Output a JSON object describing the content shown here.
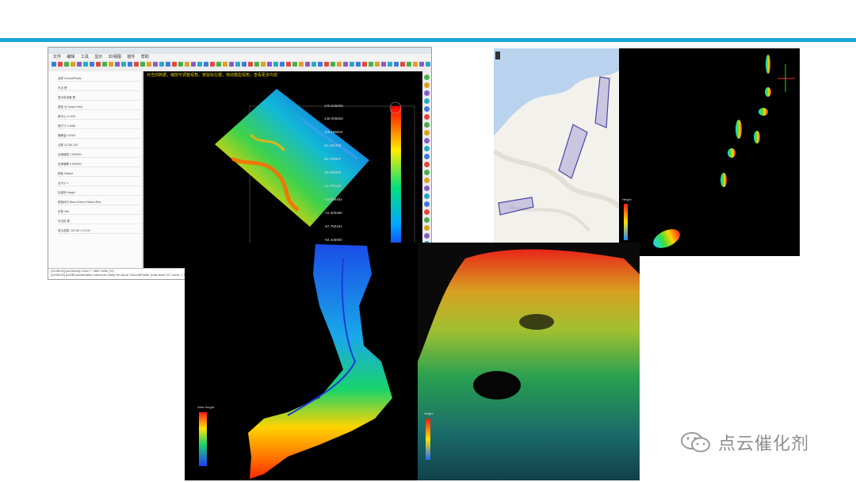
{
  "slide": {
    "accent_color": "#1aa7d8",
    "watermark": {
      "icon": "wechat-icon",
      "text": "点云催化剂"
    }
  },
  "cloudcompare": {
    "menu": [
      "文件",
      "编辑",
      "工具",
      "显示",
      "3D视图",
      "插件",
      "帮助"
    ],
    "notice": "对当前数据，缩放可调整视角，按鼠标左键，拖动模型视角，查看更多内容",
    "properties": [
      {
        "label": "名称",
        "value": "GroundPoints"
      },
      {
        "label": "可见",
        "value": "是"
      },
      {
        "label": "显示色深度",
        "value": "是"
      },
      {
        "label": "类型",
        "value": "点 Scalar Field"
      },
      {
        "label": "框中心",
        "value": "0.1234"
      },
      {
        "label": "框尺寸",
        "value": "2.3456"
      },
      {
        "label": "偏移量",
        "value": "0.0000"
      },
      {
        "label": "点数",
        "value": "24,301,347"
      },
      {
        "label": "全局缩放",
        "value": "1.000000"
      },
      {
        "label": "全局偏移",
        "value": "0.000000"
      },
      {
        "label": "颜色",
        "value": "Default"
      },
      {
        "label": "点大小",
        "value": "1"
      },
      {
        "label": "标量场",
        "value": "Height"
      },
      {
        "label": "颜色标尺",
        "value": "Blue>Green>Yellow>Red"
      },
      {
        "label": "步数",
        "value": "256"
      },
      {
        "label": "可见性",
        "value": "是"
      },
      {
        "label": "显示范围",
        "value": "-122.96 / 170.03"
      }
    ],
    "scale_values": [
      "170.025000",
      "146.006826",
      "119.188202",
      "92.425409",
      "65.730607",
      "39.005093",
      "12.375134",
      "-14.528454",
      "-41.400465",
      "-67.750151",
      "-94.448000",
      "-122.988754"
    ],
    "console": [
      "[15:06:00] [ccOctree] Level 7: 9867 cells (+0)",
      "[15:06:00] [ccOctree] Level 8: 34898 cells (+0)",
      "[15:06:00] [ccOctree] Level 9: 127495 cells (+0)",
      "[15:06:00] [ccDB] Acceleration structure ready for cloud 'GroundPoints' (max level 10 / mem. = 17.11 Mb / duration: 0.8 s)"
    ]
  },
  "lidar_panel": {
    "legend_title": "Height"
  },
  "fjord_panel": {
    "legend_title": "Wert Height"
  },
  "forest_panel": {
    "legend_title": "Height"
  }
}
